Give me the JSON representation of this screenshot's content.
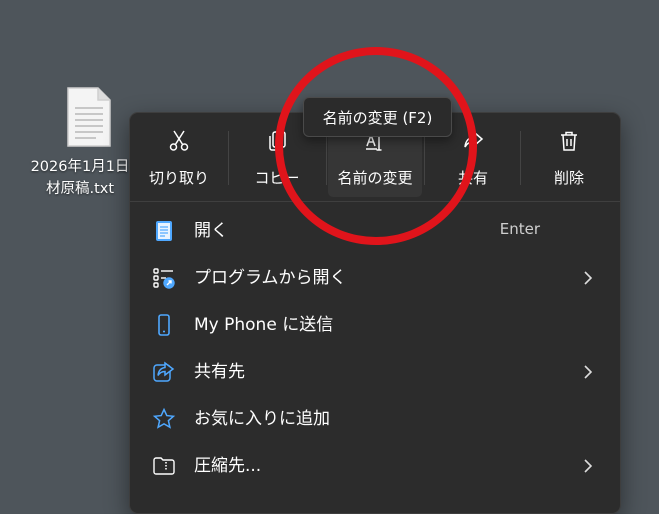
{
  "desktop": {
    "file_label_line1": "2026年1月1日",
    "file_label_line2": "材原稿.txt"
  },
  "toolbar": {
    "cut_label": "切り取り",
    "copy_label": "コピー",
    "rename_label": "名前の変更",
    "share_label": "共有",
    "delete_label": "削除"
  },
  "tooltip": {
    "text": "名前の変更 (F2)"
  },
  "menu_items": [
    {
      "label": "開く",
      "shortcut": "Enter",
      "icon": "notepad-icon"
    },
    {
      "label": "プログラムから開く",
      "icon": "open-with-icon",
      "submenu": true
    },
    {
      "label": "My Phone に送信",
      "icon": "phone-icon"
    },
    {
      "label": "共有先",
      "icon": "share-to-icon",
      "submenu": true
    },
    {
      "label": "お気に入りに追加",
      "icon": "star-icon"
    },
    {
      "label": "圧縮先...",
      "icon": "zip-folder-icon",
      "submenu": true
    }
  ],
  "colors": {
    "desktop_bg": "#4e555b",
    "menu_bg": "#2c2c2c",
    "accent_blue": "#4fa8ff",
    "annotation_red": "#e0141b"
  }
}
